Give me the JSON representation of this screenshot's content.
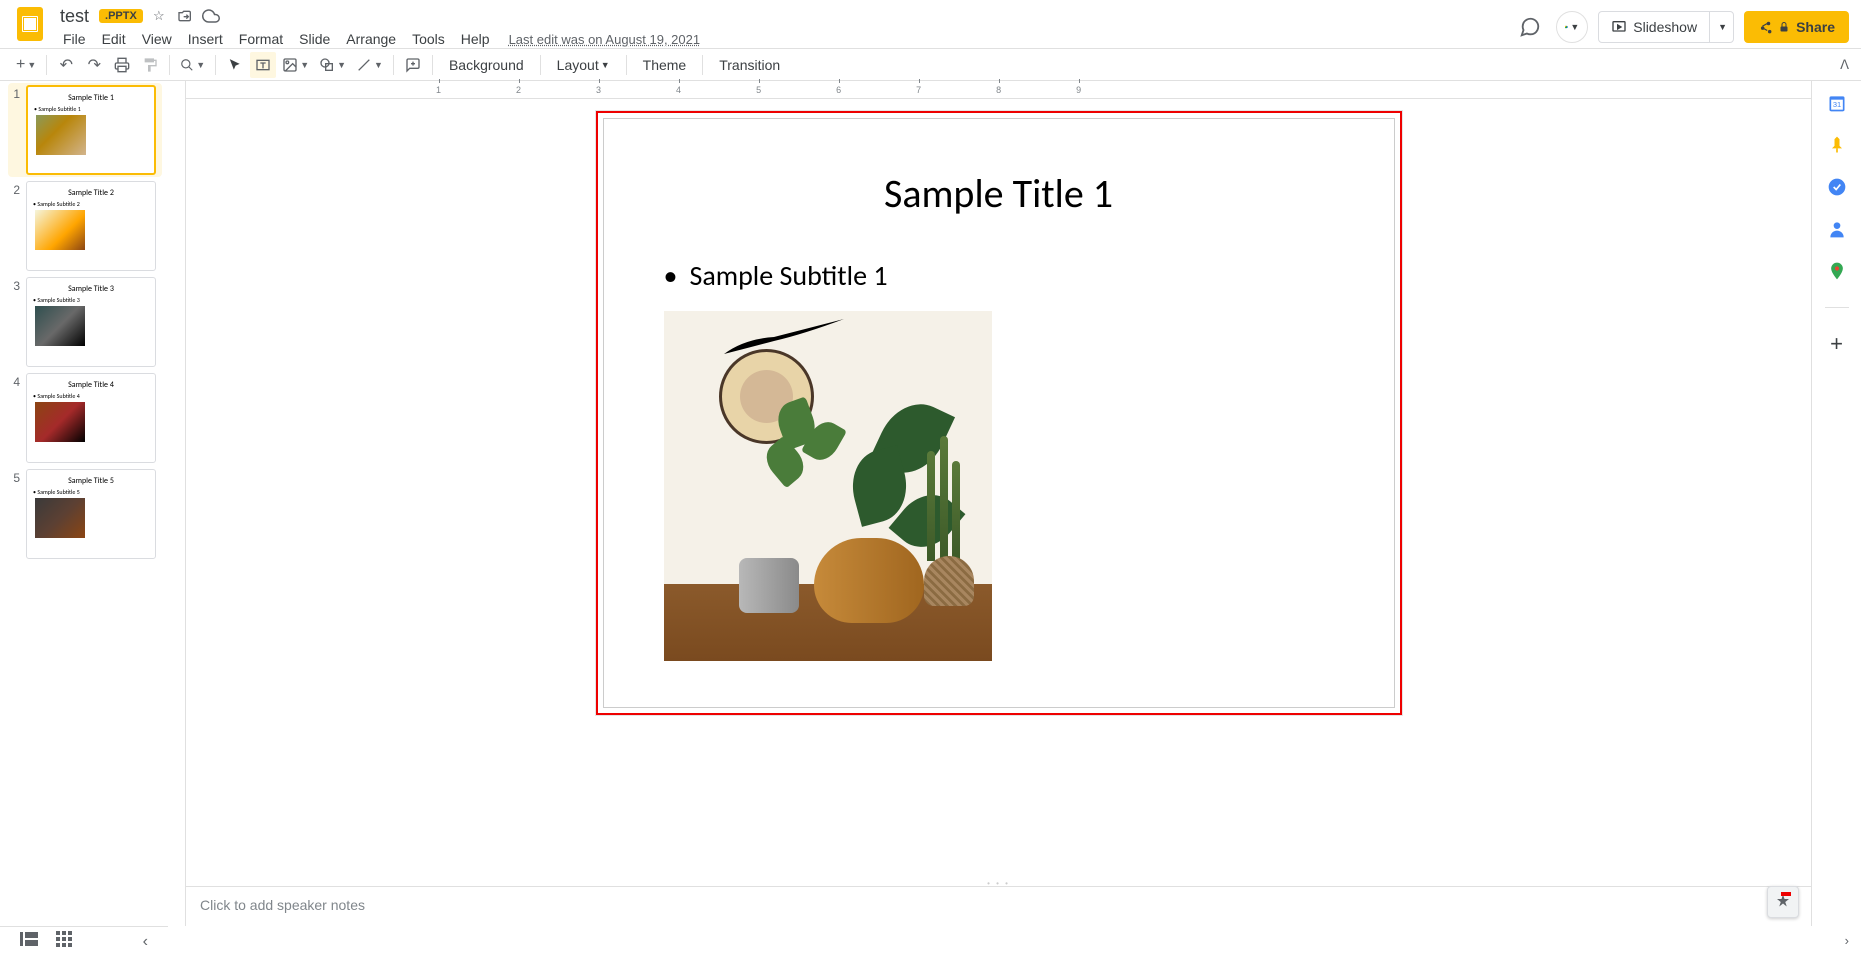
{
  "header": {
    "doc_title": "test",
    "ext_badge": ".PPTX",
    "last_edit": "Last edit was on August 19, 2021",
    "menus": [
      "File",
      "Edit",
      "View",
      "Insert",
      "Format",
      "Slide",
      "Arrange",
      "Tools",
      "Help"
    ],
    "slideshow_label": "Slideshow",
    "share_label": "Share"
  },
  "toolbar": {
    "background": "Background",
    "layout": "Layout",
    "theme": "Theme",
    "transition": "Transition"
  },
  "ruler_numbers": [
    "1",
    "2",
    "3",
    "4",
    "5",
    "6",
    "7",
    "8",
    "9"
  ],
  "slides": [
    {
      "num": "1",
      "title": "Sample Title 1",
      "subtitle": "Sample Subtitle 1"
    },
    {
      "num": "2",
      "title": "Sample Title 2",
      "subtitle": "Sample Subtitle 2"
    },
    {
      "num": "3",
      "title": "Sample Title 3",
      "subtitle": "Sample Subtitle 3"
    },
    {
      "num": "4",
      "title": "Sample Title 4",
      "subtitle": "Sample Subtitle 4"
    },
    {
      "num": "5",
      "title": "Sample Title 5",
      "subtitle": "Sample Subtitle 5"
    }
  ],
  "current_slide": {
    "title": "Sample Title 1",
    "subtitle": "Sample Subtitle 1"
  },
  "notes": {
    "placeholder": "Click to add speaker notes"
  }
}
